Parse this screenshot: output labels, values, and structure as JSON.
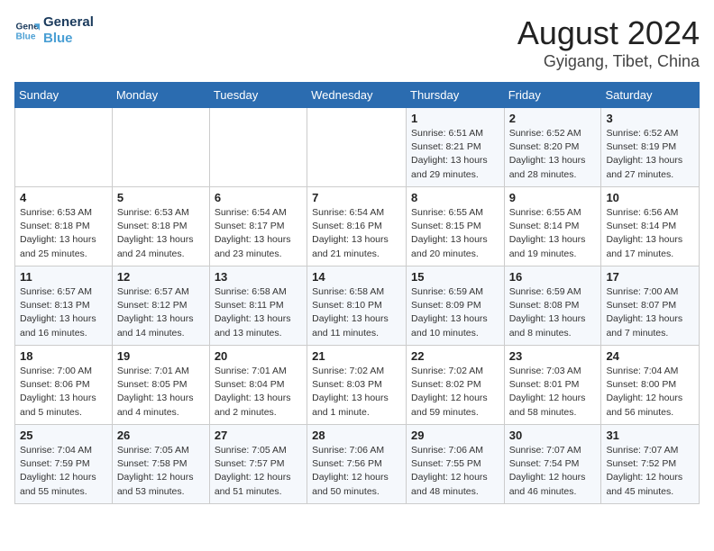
{
  "header": {
    "logo_line1": "General",
    "logo_line2": "Blue",
    "month": "August 2024",
    "location": "Gyigang, Tibet, China"
  },
  "weekdays": [
    "Sunday",
    "Monday",
    "Tuesday",
    "Wednesday",
    "Thursday",
    "Friday",
    "Saturday"
  ],
  "weeks": [
    [
      {
        "day": "",
        "info": ""
      },
      {
        "day": "",
        "info": ""
      },
      {
        "day": "",
        "info": ""
      },
      {
        "day": "",
        "info": ""
      },
      {
        "day": "1",
        "info": "Sunrise: 6:51 AM\nSunset: 8:21 PM\nDaylight: 13 hours and 29 minutes."
      },
      {
        "day": "2",
        "info": "Sunrise: 6:52 AM\nSunset: 8:20 PM\nDaylight: 13 hours and 28 minutes."
      },
      {
        "day": "3",
        "info": "Sunrise: 6:52 AM\nSunset: 8:19 PM\nDaylight: 13 hours and 27 minutes."
      }
    ],
    [
      {
        "day": "4",
        "info": "Sunrise: 6:53 AM\nSunset: 8:18 PM\nDaylight: 13 hours and 25 minutes."
      },
      {
        "day": "5",
        "info": "Sunrise: 6:53 AM\nSunset: 8:18 PM\nDaylight: 13 hours and 24 minutes."
      },
      {
        "day": "6",
        "info": "Sunrise: 6:54 AM\nSunset: 8:17 PM\nDaylight: 13 hours and 23 minutes."
      },
      {
        "day": "7",
        "info": "Sunrise: 6:54 AM\nSunset: 8:16 PM\nDaylight: 13 hours and 21 minutes."
      },
      {
        "day": "8",
        "info": "Sunrise: 6:55 AM\nSunset: 8:15 PM\nDaylight: 13 hours and 20 minutes."
      },
      {
        "day": "9",
        "info": "Sunrise: 6:55 AM\nSunset: 8:14 PM\nDaylight: 13 hours and 19 minutes."
      },
      {
        "day": "10",
        "info": "Sunrise: 6:56 AM\nSunset: 8:14 PM\nDaylight: 13 hours and 17 minutes."
      }
    ],
    [
      {
        "day": "11",
        "info": "Sunrise: 6:57 AM\nSunset: 8:13 PM\nDaylight: 13 hours and 16 minutes."
      },
      {
        "day": "12",
        "info": "Sunrise: 6:57 AM\nSunset: 8:12 PM\nDaylight: 13 hours and 14 minutes."
      },
      {
        "day": "13",
        "info": "Sunrise: 6:58 AM\nSunset: 8:11 PM\nDaylight: 13 hours and 13 minutes."
      },
      {
        "day": "14",
        "info": "Sunrise: 6:58 AM\nSunset: 8:10 PM\nDaylight: 13 hours and 11 minutes."
      },
      {
        "day": "15",
        "info": "Sunrise: 6:59 AM\nSunset: 8:09 PM\nDaylight: 13 hours and 10 minutes."
      },
      {
        "day": "16",
        "info": "Sunrise: 6:59 AM\nSunset: 8:08 PM\nDaylight: 13 hours and 8 minutes."
      },
      {
        "day": "17",
        "info": "Sunrise: 7:00 AM\nSunset: 8:07 PM\nDaylight: 13 hours and 7 minutes."
      }
    ],
    [
      {
        "day": "18",
        "info": "Sunrise: 7:00 AM\nSunset: 8:06 PM\nDaylight: 13 hours and 5 minutes."
      },
      {
        "day": "19",
        "info": "Sunrise: 7:01 AM\nSunset: 8:05 PM\nDaylight: 13 hours and 4 minutes."
      },
      {
        "day": "20",
        "info": "Sunrise: 7:01 AM\nSunset: 8:04 PM\nDaylight: 13 hours and 2 minutes."
      },
      {
        "day": "21",
        "info": "Sunrise: 7:02 AM\nSunset: 8:03 PM\nDaylight: 13 hours and 1 minute."
      },
      {
        "day": "22",
        "info": "Sunrise: 7:02 AM\nSunset: 8:02 PM\nDaylight: 12 hours and 59 minutes."
      },
      {
        "day": "23",
        "info": "Sunrise: 7:03 AM\nSunset: 8:01 PM\nDaylight: 12 hours and 58 minutes."
      },
      {
        "day": "24",
        "info": "Sunrise: 7:04 AM\nSunset: 8:00 PM\nDaylight: 12 hours and 56 minutes."
      }
    ],
    [
      {
        "day": "25",
        "info": "Sunrise: 7:04 AM\nSunset: 7:59 PM\nDaylight: 12 hours and 55 minutes."
      },
      {
        "day": "26",
        "info": "Sunrise: 7:05 AM\nSunset: 7:58 PM\nDaylight: 12 hours and 53 minutes."
      },
      {
        "day": "27",
        "info": "Sunrise: 7:05 AM\nSunset: 7:57 PM\nDaylight: 12 hours and 51 minutes."
      },
      {
        "day": "28",
        "info": "Sunrise: 7:06 AM\nSunset: 7:56 PM\nDaylight: 12 hours and 50 minutes."
      },
      {
        "day": "29",
        "info": "Sunrise: 7:06 AM\nSunset: 7:55 PM\nDaylight: 12 hours and 48 minutes."
      },
      {
        "day": "30",
        "info": "Sunrise: 7:07 AM\nSunset: 7:54 PM\nDaylight: 12 hours and 46 minutes."
      },
      {
        "day": "31",
        "info": "Sunrise: 7:07 AM\nSunset: 7:52 PM\nDaylight: 12 hours and 45 minutes."
      }
    ]
  ]
}
